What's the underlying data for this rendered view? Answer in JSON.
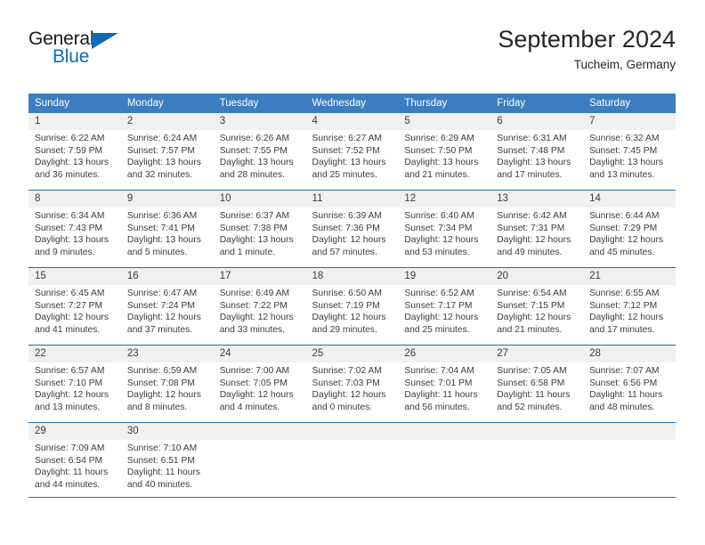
{
  "brand": {
    "word_one": "General",
    "word_two": "Blue",
    "triangle_icon": "triangle-icon"
  },
  "header": {
    "title": "September 2024",
    "location": "Tucheim, Germany"
  },
  "colors": {
    "header_blue": "#3b7dc0",
    "rule_blue": "#1f6cb0",
    "band_gray": "#f0f0f0",
    "brand_blue": "#1268b3",
    "text": "#3c3c3c"
  },
  "weekday_headers": [
    "Sunday",
    "Monday",
    "Tuesday",
    "Wednesday",
    "Thursday",
    "Friday",
    "Saturday"
  ],
  "labels": {
    "sunrise_prefix": "Sunrise:",
    "sunset_prefix": "Sunset:",
    "daylight_prefix": "Daylight:"
  },
  "weeks": [
    [
      {
        "day": "1",
        "sunrise": "Sunrise: 6:22 AM",
        "sunset": "Sunset: 7:59 PM",
        "daylight1": "Daylight: 13 hours",
        "daylight2": "and 36 minutes."
      },
      {
        "day": "2",
        "sunrise": "Sunrise: 6:24 AM",
        "sunset": "Sunset: 7:57 PM",
        "daylight1": "Daylight: 13 hours",
        "daylight2": "and 32 minutes."
      },
      {
        "day": "3",
        "sunrise": "Sunrise: 6:26 AM",
        "sunset": "Sunset: 7:55 PM",
        "daylight1": "Daylight: 13 hours",
        "daylight2": "and 28 minutes."
      },
      {
        "day": "4",
        "sunrise": "Sunrise: 6:27 AM",
        "sunset": "Sunset: 7:52 PM",
        "daylight1": "Daylight: 13 hours",
        "daylight2": "and 25 minutes."
      },
      {
        "day": "5",
        "sunrise": "Sunrise: 6:29 AM",
        "sunset": "Sunset: 7:50 PM",
        "daylight1": "Daylight: 13 hours",
        "daylight2": "and 21 minutes."
      },
      {
        "day": "6",
        "sunrise": "Sunrise: 6:31 AM",
        "sunset": "Sunset: 7:48 PM",
        "daylight1": "Daylight: 13 hours",
        "daylight2": "and 17 minutes."
      },
      {
        "day": "7",
        "sunrise": "Sunrise: 6:32 AM",
        "sunset": "Sunset: 7:45 PM",
        "daylight1": "Daylight: 13 hours",
        "daylight2": "and 13 minutes."
      }
    ],
    [
      {
        "day": "8",
        "sunrise": "Sunrise: 6:34 AM",
        "sunset": "Sunset: 7:43 PM",
        "daylight1": "Daylight: 13 hours",
        "daylight2": "and 9 minutes."
      },
      {
        "day": "9",
        "sunrise": "Sunrise: 6:36 AM",
        "sunset": "Sunset: 7:41 PM",
        "daylight1": "Daylight: 13 hours",
        "daylight2": "and 5 minutes."
      },
      {
        "day": "10",
        "sunrise": "Sunrise: 6:37 AM",
        "sunset": "Sunset: 7:38 PM",
        "daylight1": "Daylight: 13 hours",
        "daylight2": "and 1 minute."
      },
      {
        "day": "11",
        "sunrise": "Sunrise: 6:39 AM",
        "sunset": "Sunset: 7:36 PM",
        "daylight1": "Daylight: 12 hours",
        "daylight2": "and 57 minutes."
      },
      {
        "day": "12",
        "sunrise": "Sunrise: 6:40 AM",
        "sunset": "Sunset: 7:34 PM",
        "daylight1": "Daylight: 12 hours",
        "daylight2": "and 53 minutes."
      },
      {
        "day": "13",
        "sunrise": "Sunrise: 6:42 AM",
        "sunset": "Sunset: 7:31 PM",
        "daylight1": "Daylight: 12 hours",
        "daylight2": "and 49 minutes."
      },
      {
        "day": "14",
        "sunrise": "Sunrise: 6:44 AM",
        "sunset": "Sunset: 7:29 PM",
        "daylight1": "Daylight: 12 hours",
        "daylight2": "and 45 minutes."
      }
    ],
    [
      {
        "day": "15",
        "sunrise": "Sunrise: 6:45 AM",
        "sunset": "Sunset: 7:27 PM",
        "daylight1": "Daylight: 12 hours",
        "daylight2": "and 41 minutes."
      },
      {
        "day": "16",
        "sunrise": "Sunrise: 6:47 AM",
        "sunset": "Sunset: 7:24 PM",
        "daylight1": "Daylight: 12 hours",
        "daylight2": "and 37 minutes."
      },
      {
        "day": "17",
        "sunrise": "Sunrise: 6:49 AM",
        "sunset": "Sunset: 7:22 PM",
        "daylight1": "Daylight: 12 hours",
        "daylight2": "and 33 minutes."
      },
      {
        "day": "18",
        "sunrise": "Sunrise: 6:50 AM",
        "sunset": "Sunset: 7:19 PM",
        "daylight1": "Daylight: 12 hours",
        "daylight2": "and 29 minutes."
      },
      {
        "day": "19",
        "sunrise": "Sunrise: 6:52 AM",
        "sunset": "Sunset: 7:17 PM",
        "daylight1": "Daylight: 12 hours",
        "daylight2": "and 25 minutes."
      },
      {
        "day": "20",
        "sunrise": "Sunrise: 6:54 AM",
        "sunset": "Sunset: 7:15 PM",
        "daylight1": "Daylight: 12 hours",
        "daylight2": "and 21 minutes."
      },
      {
        "day": "21",
        "sunrise": "Sunrise: 6:55 AM",
        "sunset": "Sunset: 7:12 PM",
        "daylight1": "Daylight: 12 hours",
        "daylight2": "and 17 minutes."
      }
    ],
    [
      {
        "day": "22",
        "sunrise": "Sunrise: 6:57 AM",
        "sunset": "Sunset: 7:10 PM",
        "daylight1": "Daylight: 12 hours",
        "daylight2": "and 13 minutes."
      },
      {
        "day": "23",
        "sunrise": "Sunrise: 6:59 AM",
        "sunset": "Sunset: 7:08 PM",
        "daylight1": "Daylight: 12 hours",
        "daylight2": "and 8 minutes."
      },
      {
        "day": "24",
        "sunrise": "Sunrise: 7:00 AM",
        "sunset": "Sunset: 7:05 PM",
        "daylight1": "Daylight: 12 hours",
        "daylight2": "and 4 minutes."
      },
      {
        "day": "25",
        "sunrise": "Sunrise: 7:02 AM",
        "sunset": "Sunset: 7:03 PM",
        "daylight1": "Daylight: 12 hours",
        "daylight2": "and 0 minutes."
      },
      {
        "day": "26",
        "sunrise": "Sunrise: 7:04 AM",
        "sunset": "Sunset: 7:01 PM",
        "daylight1": "Daylight: 11 hours",
        "daylight2": "and 56 minutes."
      },
      {
        "day": "27",
        "sunrise": "Sunrise: 7:05 AM",
        "sunset": "Sunset: 6:58 PM",
        "daylight1": "Daylight: 11 hours",
        "daylight2": "and 52 minutes."
      },
      {
        "day": "28",
        "sunrise": "Sunrise: 7:07 AM",
        "sunset": "Sunset: 6:56 PM",
        "daylight1": "Daylight: 11 hours",
        "daylight2": "and 48 minutes."
      }
    ],
    [
      {
        "day": "29",
        "sunrise": "Sunrise: 7:09 AM",
        "sunset": "Sunset: 6:54 PM",
        "daylight1": "Daylight: 11 hours",
        "daylight2": "and 44 minutes."
      },
      {
        "day": "30",
        "sunrise": "Sunrise: 7:10 AM",
        "sunset": "Sunset: 6:51 PM",
        "daylight1": "Daylight: 11 hours",
        "daylight2": "and 40 minutes."
      },
      {
        "day": "",
        "sunrise": "",
        "sunset": "",
        "daylight1": "",
        "daylight2": ""
      },
      {
        "day": "",
        "sunrise": "",
        "sunset": "",
        "daylight1": "",
        "daylight2": ""
      },
      {
        "day": "",
        "sunrise": "",
        "sunset": "",
        "daylight1": "",
        "daylight2": ""
      },
      {
        "day": "",
        "sunrise": "",
        "sunset": "",
        "daylight1": "",
        "daylight2": ""
      },
      {
        "day": "",
        "sunrise": "",
        "sunset": "",
        "daylight1": "",
        "daylight2": ""
      }
    ]
  ]
}
